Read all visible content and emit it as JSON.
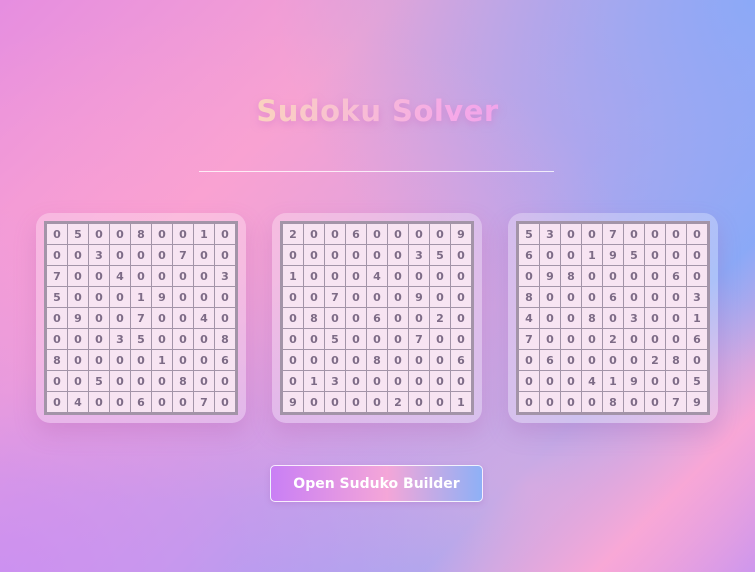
{
  "header": {
    "title": "Sudoku Solver"
  },
  "boards": [
    {
      "grid": [
        [
          0,
          5,
          0,
          0,
          8,
          0,
          0,
          1,
          0
        ],
        [
          0,
          0,
          3,
          0,
          0,
          0,
          7,
          0,
          0
        ],
        [
          7,
          0,
          0,
          4,
          0,
          0,
          0,
          0,
          3
        ],
        [
          5,
          0,
          0,
          0,
          1,
          9,
          0,
          0,
          0
        ],
        [
          0,
          9,
          0,
          0,
          7,
          0,
          0,
          4,
          0
        ],
        [
          0,
          0,
          0,
          3,
          5,
          0,
          0,
          0,
          8
        ],
        [
          8,
          0,
          0,
          0,
          0,
          1,
          0,
          0,
          6
        ],
        [
          0,
          0,
          5,
          0,
          0,
          0,
          8,
          0,
          0
        ],
        [
          0,
          4,
          0,
          0,
          6,
          0,
          0,
          7,
          0
        ]
      ]
    },
    {
      "grid": [
        [
          2,
          0,
          0,
          6,
          0,
          0,
          0,
          0,
          9
        ],
        [
          0,
          0,
          0,
          0,
          0,
          0,
          3,
          5,
          0
        ],
        [
          1,
          0,
          0,
          0,
          4,
          0,
          0,
          0,
          0
        ],
        [
          0,
          0,
          7,
          0,
          0,
          0,
          9,
          0,
          0
        ],
        [
          0,
          8,
          0,
          0,
          6,
          0,
          0,
          2,
          0
        ],
        [
          0,
          0,
          5,
          0,
          0,
          0,
          7,
          0,
          0
        ],
        [
          0,
          0,
          0,
          0,
          8,
          0,
          0,
          0,
          6
        ],
        [
          0,
          1,
          3,
          0,
          0,
          0,
          0,
          0,
          0
        ],
        [
          9,
          0,
          0,
          0,
          0,
          2,
          0,
          0,
          1
        ]
      ]
    },
    {
      "grid": [
        [
          5,
          3,
          0,
          0,
          7,
          0,
          0,
          0,
          0
        ],
        [
          6,
          0,
          0,
          1,
          9,
          5,
          0,
          0,
          0
        ],
        [
          0,
          9,
          8,
          0,
          0,
          0,
          0,
          6,
          0
        ],
        [
          8,
          0,
          0,
          0,
          6,
          0,
          0,
          0,
          3
        ],
        [
          4,
          0,
          0,
          8,
          0,
          3,
          0,
          0,
          1
        ],
        [
          7,
          0,
          0,
          0,
          2,
          0,
          0,
          0,
          6
        ],
        [
          0,
          6,
          0,
          0,
          0,
          0,
          2,
          8,
          0
        ],
        [
          0,
          0,
          0,
          4,
          1,
          9,
          0,
          0,
          5
        ],
        [
          0,
          0,
          0,
          0,
          8,
          0,
          0,
          7,
          9
        ]
      ]
    }
  ],
  "actions": {
    "open_builder_label": "Open Suduko Builder"
  }
}
